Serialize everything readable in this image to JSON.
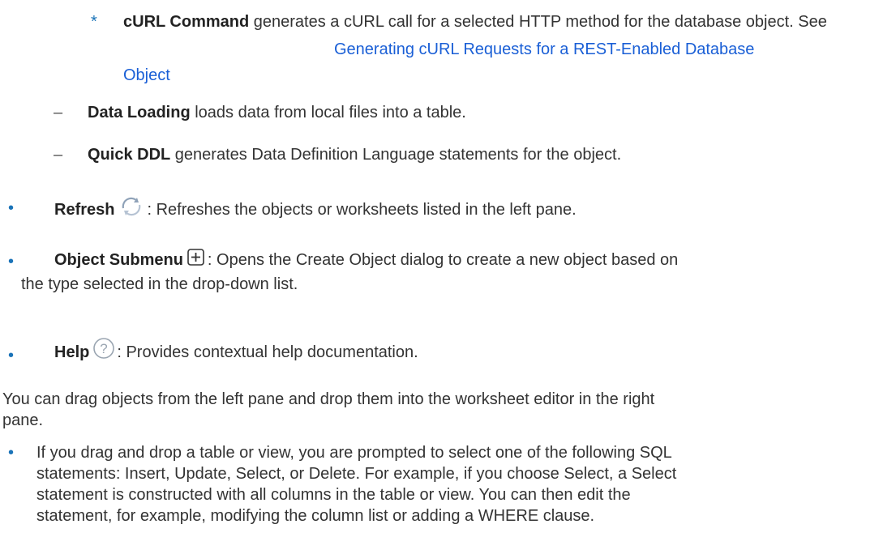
{
  "curl": {
    "bullet": "*",
    "term": "cURL Command",
    "text": " generates a cURL call for a selected HTTP method for the database object. See ",
    "link_line1": "Generating cURL Requests for a REST-Enabled Database",
    "link_line2": "Object"
  },
  "data_loading": {
    "bullet": "–",
    "term": "Data Loading",
    "text": " loads data from local files into a table."
  },
  "quick_ddl": {
    "bullet": "–",
    "term": "Quick DDL",
    "text": " generates Data Definition Language statements for the object."
  },
  "refresh": {
    "bullet": "•",
    "term": "Refresh",
    "text": ": Refreshes the objects or worksheets listed in the left pane.",
    "icon": "refresh-icon"
  },
  "object_submenu": {
    "bullet": "•",
    "term": "Object Submenu",
    "text_line1": ": Opens the Create Object dialog to create a new object based on",
    "text_line2": "the type selected in the drop-down list.",
    "icon": "plus-box-icon"
  },
  "help": {
    "bullet": "•",
    "term": "Help",
    "text": ": Provides contextual help documentation.",
    "icon": "question-circle-icon"
  },
  "drag_para": {
    "line1": "You can drag objects from the left pane and drop them into the worksheet editor in the right",
    "line2": "pane."
  },
  "drag_table": {
    "bullet": "•",
    "line1": "If you drag and drop a table or view, you are prompted to select one of the following SQL",
    "line2": "statements: Insert, Update, Select, or Delete. For example, if you choose Select, a Select",
    "line3": "statement is constructed with all columns in the table or view. You can then edit the",
    "line4": "statement, for example, modifying the column list or adding a WHERE clause."
  },
  "colors": {
    "link": "#1a5fd6",
    "bullet": "#1a73b8",
    "text": "#333333"
  }
}
